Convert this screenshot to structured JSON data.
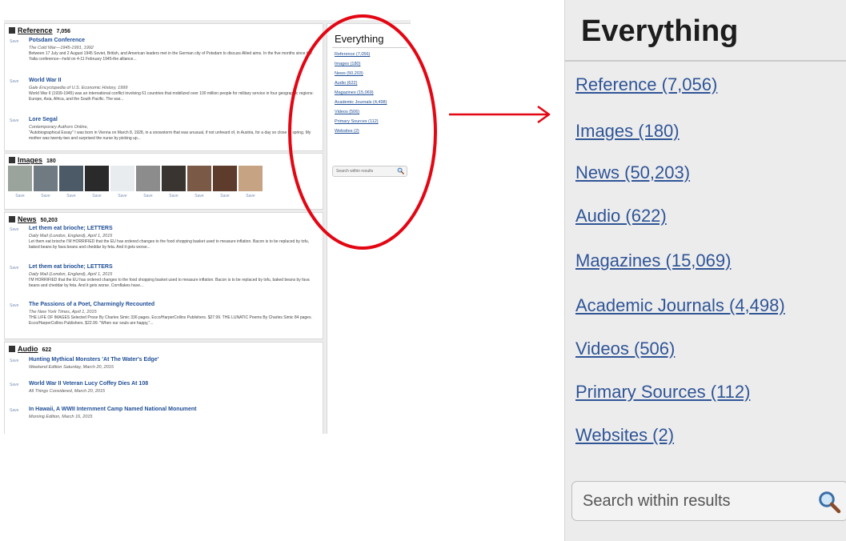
{
  "results": {
    "reference": {
      "title": "Reference",
      "count": "7,056",
      "items": [
        {
          "save": "Save",
          "title": "Potsdam Conference",
          "source": "The Cold War—1945-1991, 1992",
          "snippet": "Between 17 July and 2 August 1945 Soviet, British, and American leaders met in the German city of Potsdam to discuss Allied aims. In the five months since the Yalta conference—held on 4-11 February 1945-the alliance..."
        },
        {
          "save": "Save",
          "title": "World War II",
          "source": "Gale Encyclopedia of U.S. Economic History, 1999",
          "snippet": "World War II (1939-1945) was an international conflict involving 61 countries that mobilized over 100 million people for military service in four geographic regions: Europe, Asia, Africa, and the South Pacific. The war..."
        },
        {
          "save": "Save",
          "title": "Lore Segal",
          "source": "Contemporary Authors Online,",
          "snippet": "\"Autobiographical Essay\" I was born in Vienna on March 8, 1928, in a snowstorm that was unusual, if not unheard of, in Austria, for a day so close to spring. My mother was twenty-two and surprised the nurse by picking up..."
        }
      ]
    },
    "images": {
      "title": "Images",
      "count": "180",
      "save_label": "Save",
      "thumb_colors": [
        "#9aa39c",
        "#6f7a83",
        "#4c5966",
        "#2a2a2a",
        "#e9ecee",
        "#8c8c8c",
        "#3a3430",
        "#7a5a46",
        "#5d3c2c",
        "#c6a383"
      ]
    },
    "news": {
      "title": "News",
      "count": "50,203",
      "items": [
        {
          "save": "Save",
          "title": "Let them eat brioche; LETTERS",
          "source": "Daily Mail (London, England), April 1, 2015",
          "snippet": "Let them eat brioche I'M HORRIFIED that the EU has ordered changes to the food shopping basket used to measure inflation. Bacon is to be replaced by tofu, baked beans by fava beans and cheddar by feta. And it gets worse..."
        },
        {
          "save": "Save",
          "title": "Let them eat brioche; LETTERS",
          "source": "Daily Mail (London, England), April 1, 2015",
          "snippet": "I'M HORRIFIED that the EU has ordered changes to the food shopping basket used to measure inflation. Bacon is to be replaced by tofu, baked beans by fava beans and cheddar by feta. And it gets worse. Cornflakes have..."
        },
        {
          "save": "Save",
          "title": "The Passions of a Poet, Charmingly Recounted",
          "source": "The New York Times, April 1, 2015",
          "snippet": "THE LIFE OF IMAGES Selected Prose By Charles Simic 336 pages. Ecco/HarperCollins Publishers. $27.99. THE LUNATIC Poems By Charles Simic 84 pages. Ecco/HarperCollins Publishers. $22.99. \"When our souls are happy,\"..."
        }
      ]
    },
    "audio": {
      "title": "Audio",
      "count": "622",
      "items": [
        {
          "save": "Save",
          "title": "Hunting Mythical Monsters 'At The Water's Edge'",
          "source": "Weekend Edition Saturday, March 20, 2015"
        },
        {
          "save": "Save",
          "title": "World War II Veteran Lucy Coffey Dies At 108",
          "source": "All Things Considered, March 20, 2015"
        },
        {
          "save": "Save",
          "title": "In Hawaii, A WWII Internment Camp Named National Monument",
          "source": "Morning Edition, March 16, 2015"
        }
      ]
    }
  },
  "sidebar": {
    "title": "Everything",
    "links": [
      "Reference (7,056)",
      "Images (180)",
      "News (50,203)",
      "Audio (622)",
      "Magazines (15,069)",
      "Academic Journals (4,498)",
      "Videos (506)",
      "Primary Sources (112)",
      "Websites (2)"
    ],
    "search_placeholder": "Search within results"
  },
  "colors": {
    "highlight": "#e30613",
    "link": "#2f5597",
    "title_link": "#1f4e96"
  },
  "icons": {
    "search": "magnifier-icon",
    "reference": "book-icon",
    "images": "picture-icon",
    "news": "newspaper-icon",
    "audio": "speaker-icon"
  }
}
